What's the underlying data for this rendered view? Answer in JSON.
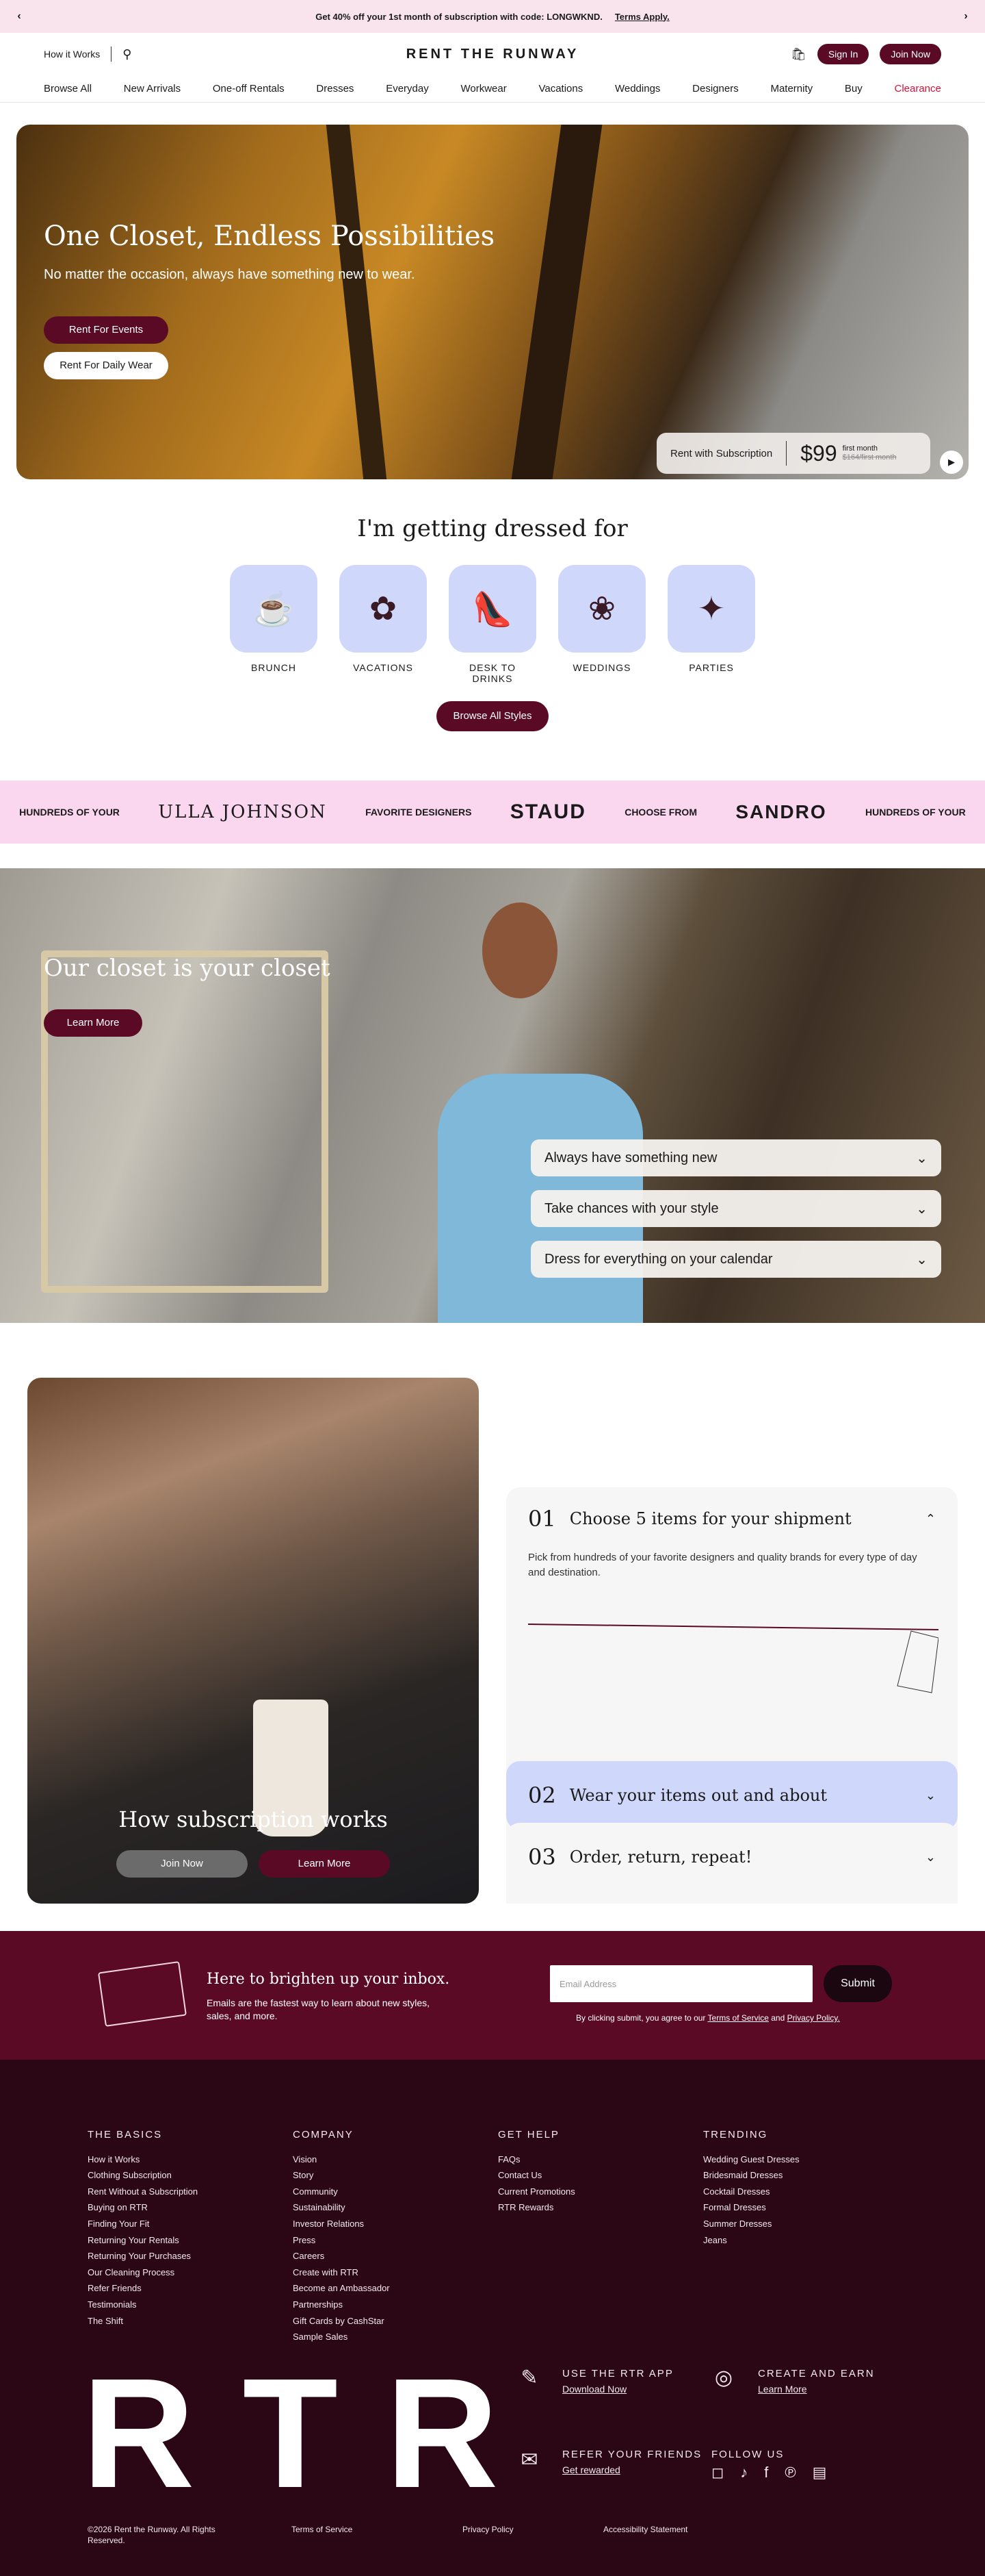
{
  "promo": {
    "text": "Get 40% off your 1st month of subscription with code: LONGWKND.",
    "link": "Terms Apply."
  },
  "header": {
    "how": "How it Works",
    "logo": "RENT THE RUNWAY",
    "signin": "Sign In",
    "join": "Join Now"
  },
  "nav": [
    "Browse All",
    "New Arrivals",
    "One-off Rentals",
    "Dresses",
    "Everyday",
    "Workwear",
    "Vacations",
    "Weddings",
    "Designers",
    "Maternity",
    "Buy",
    "Clearance"
  ],
  "hero": {
    "title": "One Closet, Endless Possibilities",
    "subtitle": "No matter the occasion, always have something new to wear.",
    "btn1": "Rent For Events",
    "btn2": "Rent For Daily Wear",
    "sub_label": "Rent with Subscription",
    "price": "$99",
    "first": "first month",
    "orig": "$164/first month"
  },
  "dressed": {
    "title": "I'm getting dressed for",
    "cats": [
      "BRUNCH",
      "VACATIONS",
      "DESK TO DRINKS",
      "WEDDINGS",
      "PARTIES"
    ],
    "browse": "Browse All Styles"
  },
  "band": [
    "HUNDREDS OF YOUR",
    "ULLA JOHNSON",
    "FAVORITE DESIGNERS",
    "STAUD",
    "CHOOSE FROM",
    "SANDRO",
    "HUNDREDS OF YOUR"
  ],
  "closet": {
    "title": "Our closet is your closet",
    "btn": "Learn More",
    "acc": [
      "Always have something new",
      "Take chances with your style",
      "Dress for everything on your calendar"
    ]
  },
  "how": {
    "title": "How subscription works",
    "join": "Join Now",
    "learn": "Learn More",
    "s1_num": "01",
    "s1": "Choose 5 items for your shipment",
    "s1_body": "Pick from hundreds of your favorite designers and quality brands for every type of day and destination.",
    "s2_num": "02",
    "s2": "Wear your items out and about",
    "s3_num": "03",
    "s3": "Order, return, repeat!"
  },
  "news": {
    "title": "Here to brighten up your inbox.",
    "body": "Emails are the fastest way to learn about new styles, sales, and more.",
    "placeholder": "Email Address",
    "submit": "Submit",
    "fine1": "By clicking submit, you agree to our",
    "tos": "Terms of Service",
    "and": "and",
    "privacy": "Privacy Policy."
  },
  "footer": {
    "basics": {
      "title": "THE BASICS",
      "items": [
        "How it Works",
        "Clothing Subscription",
        "Rent Without a Subscription",
        "Buying on RTR",
        "Finding Your Fit",
        "Returning Your Rentals",
        "Returning Your Purchases",
        "Our Cleaning Process",
        "Refer Friends",
        "Testimonials",
        "The Shift"
      ]
    },
    "company": {
      "title": "COMPANY",
      "items": [
        "Vision",
        "Story",
        "Community",
        "Sustainability",
        "Investor Relations",
        "Press",
        "Careers",
        "Create with RTR",
        "Become an Ambassador",
        "Partnerships",
        "Gift Cards by CashStar",
        "Sample Sales"
      ]
    },
    "help": {
      "title": "GET HELP",
      "items": [
        "FAQs",
        "Contact Us",
        "Current Promotions",
        "RTR Rewards"
      ]
    },
    "trending": {
      "title": "TRENDING",
      "items": [
        "Wedding Guest Dresses",
        "Bridesmaid Dresses",
        "Cocktail Dresses",
        "Formal Dresses",
        "Summer Dresses",
        "Jeans"
      ]
    },
    "rtr": "RTR",
    "app": "USE THE RTR APP",
    "app_link": "Download Now",
    "create": "CREATE AND EARN",
    "create_link": "Learn More",
    "refer": "REFER YOUR FRIENDS",
    "refer_link": "Get rewarded",
    "follow": "FOLLOW US",
    "copy": "©2026 Rent the Runway. All Rights Reserved.",
    "terms": "Terms of Service",
    "privacy": "Privacy Policy",
    "access": "Accessibility Statement"
  }
}
